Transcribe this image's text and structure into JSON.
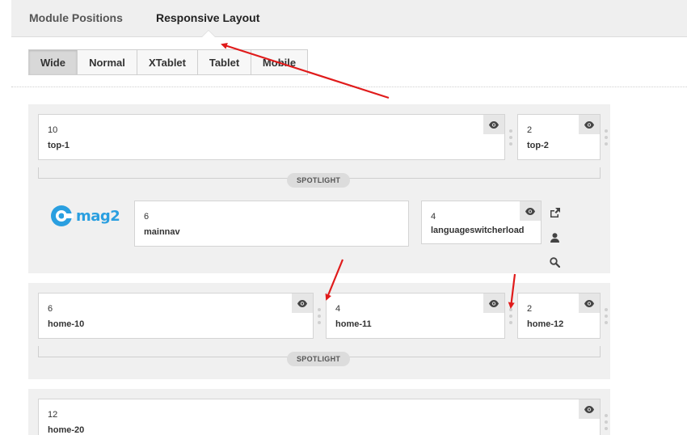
{
  "tabs": [
    {
      "label": "Module Positions",
      "active": false
    },
    {
      "label": "Responsive Layout",
      "active": true
    }
  ],
  "devices": [
    {
      "label": "Wide",
      "active": true
    },
    {
      "label": "Normal",
      "active": false
    },
    {
      "label": "XTablet",
      "active": false
    },
    {
      "label": "Tablet",
      "active": false
    },
    {
      "label": "Mobile",
      "active": false
    }
  ],
  "section1": {
    "top_1": {
      "size": "10",
      "name": "top-1"
    },
    "top_2": {
      "size": "2",
      "name": "top-2"
    },
    "spotlight": "SPOTLIGHT",
    "logo_text": "mag2",
    "mainnav": {
      "size": "6",
      "name": "mainnav"
    },
    "langswitch": {
      "size": "4",
      "name": "languageswitcherload"
    }
  },
  "section2": {
    "home_10": {
      "size": "6",
      "name": "home-10"
    },
    "home_11": {
      "size": "4",
      "name": "home-11"
    },
    "home_12": {
      "size": "2",
      "name": "home-12"
    },
    "spotlight": "SPOTLIGHT"
  },
  "section3": {
    "home_20": {
      "size": "12",
      "name": "home-20"
    }
  },
  "icons": {
    "eye": "eye-icon",
    "share": "share-icon",
    "user": "user-icon",
    "search": "search-icon"
  },
  "colors": {
    "annotation_arrow": "#e01b1b",
    "logo_blue": "#2a9fe0",
    "section_bg": "#f0f0f0"
  }
}
